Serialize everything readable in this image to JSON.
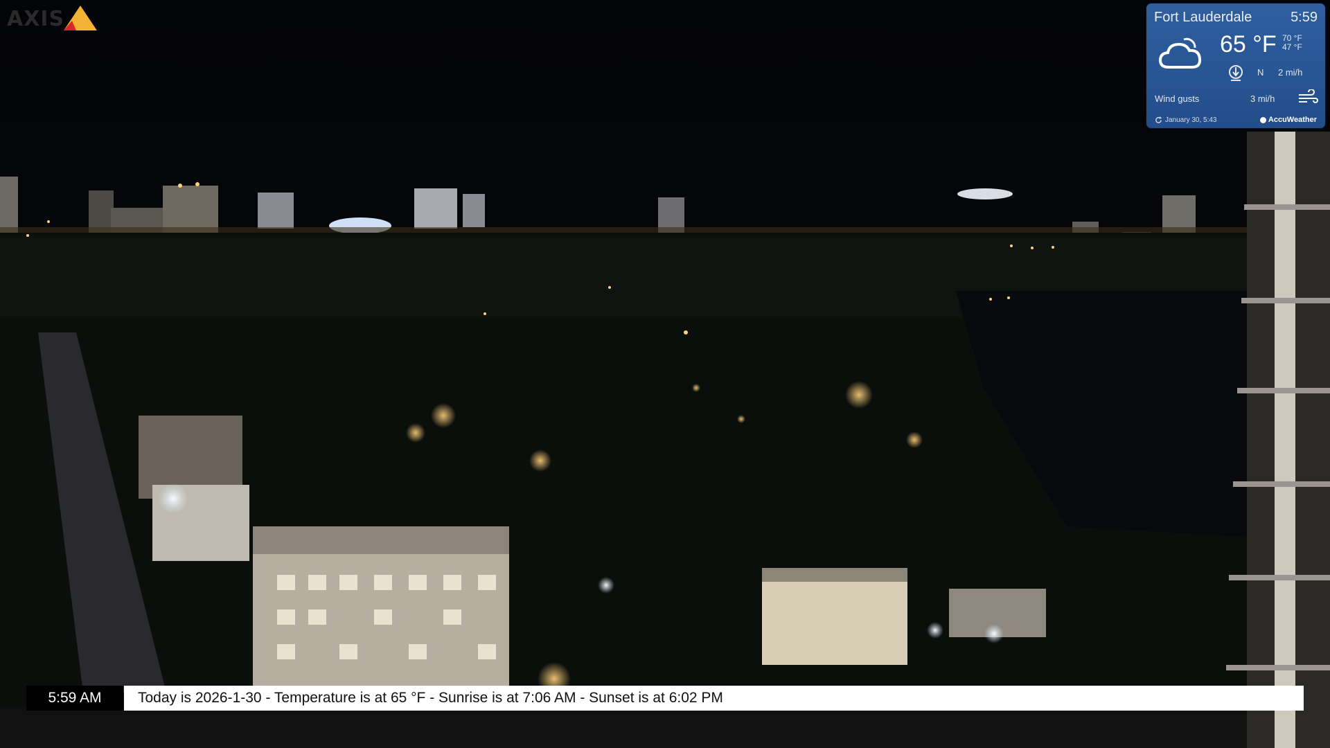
{
  "camera": {
    "brand_label": "AXIS",
    "brand_icon": "triangle-logo-icon"
  },
  "weather": {
    "city": "Fort Lauderdale",
    "time": "5:59",
    "temperature": "65 °F",
    "high": "70 °F",
    "low": "47 °F",
    "wind_direction": "N",
    "wind_speed": "2 mi/h",
    "gusts_label": "Wind gusts",
    "gusts_value": "3 mi/h",
    "updated": "January 30, 5:43",
    "provider": "AccuWeather",
    "condition_icon": "partly-cloudy-icon",
    "accent": "#2a5594"
  },
  "ticker": {
    "time": "5:59 AM",
    "message": "Today is 2026-1-30 - Temperature is at  65 °F - Sunrise is at 7:06 AM - Sunset is at 6:02 PM"
  }
}
